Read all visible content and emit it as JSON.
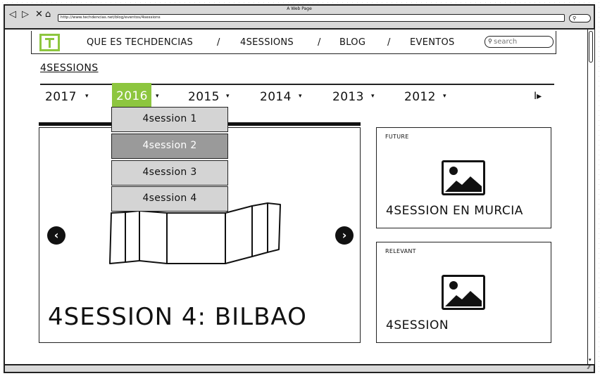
{
  "window": {
    "title": "A Web Page",
    "url": "http://www.techdencias.net/blog/eventos/4sessions",
    "nav_icons": {
      "back": "◁",
      "forward": "▷",
      "close": "✕",
      "home": "⌂"
    }
  },
  "nav": {
    "items": [
      {
        "label": "QUE ES TECHDENCIAS"
      },
      {
        "label": "4SESSIONS"
      },
      {
        "label": "BLOG"
      },
      {
        "label": "EVENTOS"
      }
    ],
    "separator": "/",
    "search_placeholder": "search"
  },
  "section": {
    "title": "4SESSIONS"
  },
  "years": {
    "items": [
      "2017",
      "2016",
      "2015",
      "2014",
      "2013",
      "2012"
    ],
    "selected": "2016",
    "next_symbol": "I▸"
  },
  "dropdown": {
    "items": [
      "4session 1",
      "4session 2",
      "4session 3",
      "4session 4"
    ],
    "selected": "4session 2"
  },
  "carousel": {
    "title": "4SESSION 4: BILBAO",
    "prev_symbol": "‹",
    "next_symbol": "›"
  },
  "cards": {
    "future": {
      "label": "FUTURE",
      "title": "4SESSION EN MURCIA"
    },
    "relevant": {
      "label": "RELEVANT",
      "title": "4SESSION"
    }
  },
  "colors": {
    "accent": "#8dc63f",
    "selected_item": "#9a9a9a",
    "dropdown_item": "#d4d4d4"
  }
}
